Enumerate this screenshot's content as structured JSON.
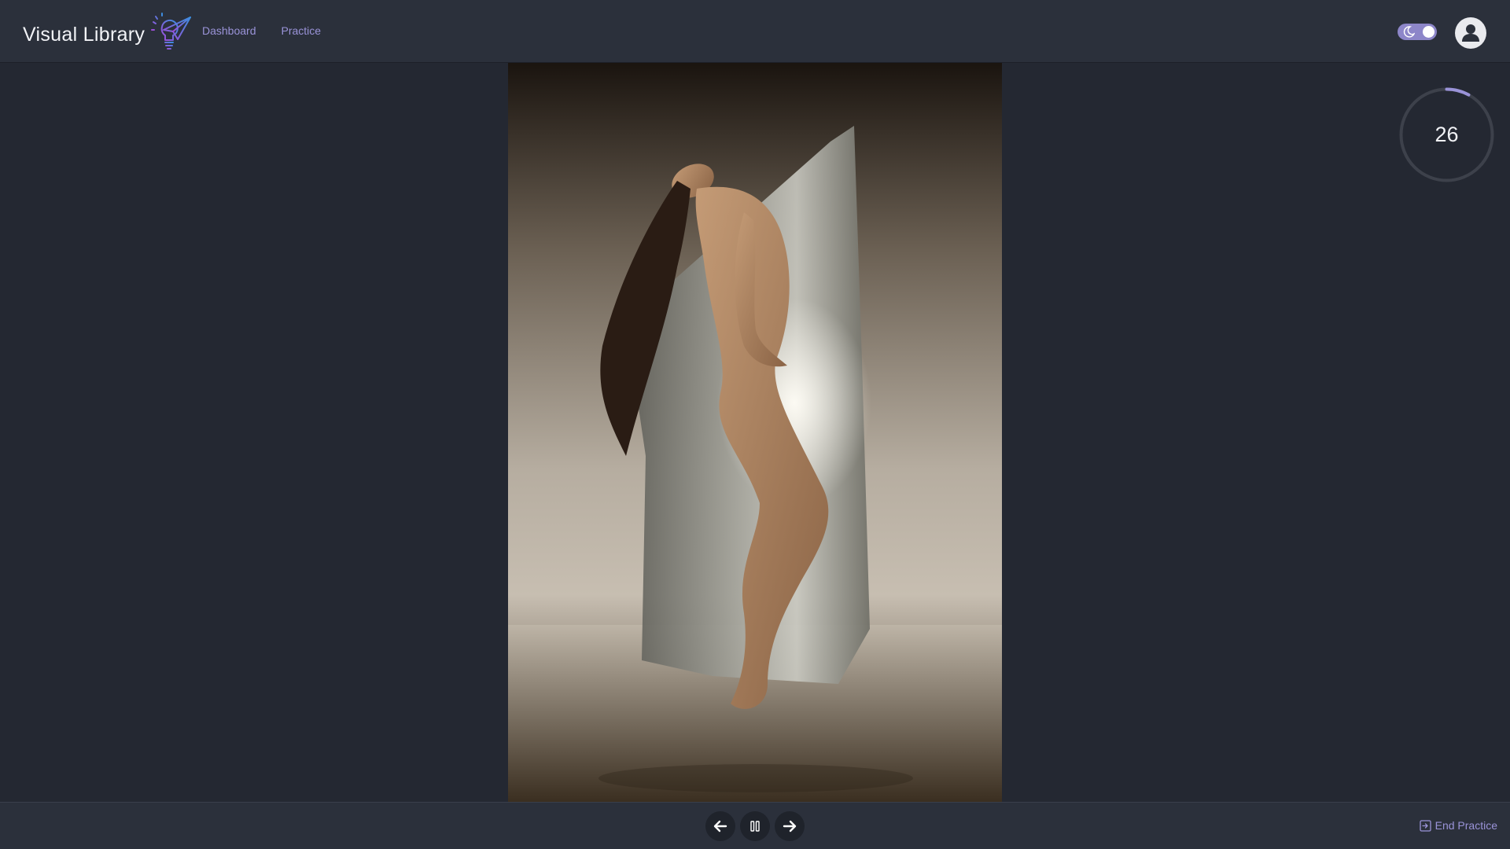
{
  "header": {
    "app_title": "Visual Library",
    "nav": [
      {
        "label": "Dashboard"
      },
      {
        "label": "Practice"
      }
    ],
    "theme_toggle": {
      "mode": "dark",
      "icon": "moon-icon"
    },
    "user_icon": "user-avatar-icon"
  },
  "session": {
    "timer_value": "26",
    "timer_progress": 0.08
  },
  "controls": {
    "previous_icon": "arrow-left-icon",
    "pause_icon": "pause-icon",
    "next_icon": "arrow-right-icon",
    "end_label": "End Practice",
    "end_icon": "exit-icon"
  },
  "colors": {
    "accent": "#9a93d8",
    "background": "#242832",
    "bar": "#2b303b"
  }
}
